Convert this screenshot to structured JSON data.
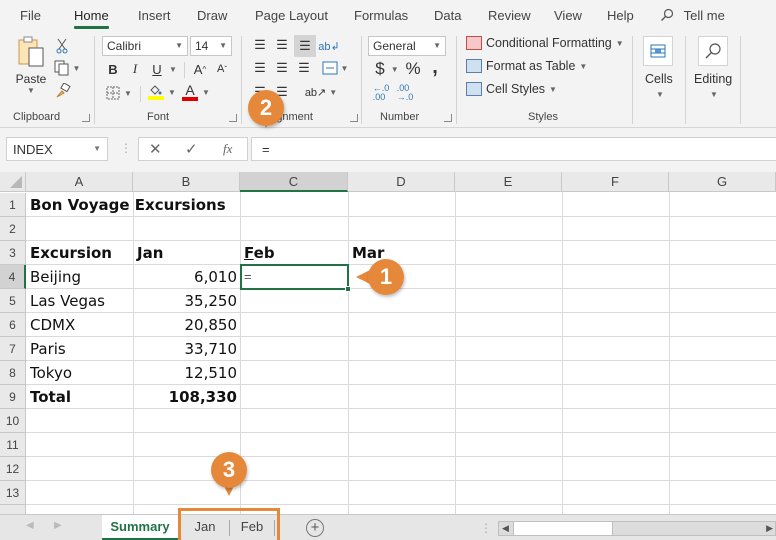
{
  "menu": {
    "tabs": [
      {
        "label": "File"
      },
      {
        "label": "Home",
        "active": true
      },
      {
        "label": "Insert"
      },
      {
        "label": "Draw"
      },
      {
        "label": "Page Layout"
      },
      {
        "label": "Formulas"
      },
      {
        "label": "Data"
      },
      {
        "label": "Review"
      },
      {
        "label": "View"
      },
      {
        "label": "Help"
      }
    ],
    "tell_me": "Tell me"
  },
  "ribbon": {
    "clipboard": {
      "paste_label": "Paste",
      "group_label": "Clipboard"
    },
    "font": {
      "font_name": "Calibri",
      "font_size": "14",
      "bold": "B",
      "italic": "I",
      "underline": "U",
      "grow": "A",
      "shrink": "A",
      "font_color_letter": "A",
      "group_label": "Font",
      "fill_color": "#ffff00",
      "font_color": "#e00000"
    },
    "alignment": {
      "group_label": "Alignment"
    },
    "number": {
      "format": "General",
      "currency": "$",
      "percent": "%",
      "comma": ",",
      "group_label": "Number"
    },
    "styles": {
      "conditional_formatting": "Conditional Formatting",
      "format_as_table": "Format as Table",
      "cell_styles": "Cell Styles",
      "group_label": "Styles"
    },
    "cells": {
      "label": "Cells"
    },
    "editing": {
      "label": "Editing"
    }
  },
  "formula_bar": {
    "name_box": "INDEX",
    "cancel": "✕",
    "enter": "✓",
    "fx": "fx",
    "formula": "="
  },
  "grid": {
    "columns": [
      "A",
      "B",
      "C",
      "D",
      "E",
      "F",
      "G"
    ],
    "selected_column": "C",
    "rows": [
      "1",
      "2",
      "3",
      "4",
      "5",
      "6",
      "7",
      "8",
      "9",
      "10",
      "11",
      "12",
      "13"
    ],
    "selected_row": "4",
    "active_cell": "C4",
    "active_cell_value": "=",
    "title": "Bon Voyage Excursions",
    "headers": [
      "Excursion",
      "Jan",
      "Feb",
      "Mar"
    ],
    "data": [
      {
        "excursion": "Beijing",
        "jan": "6,010"
      },
      {
        "excursion": "Las Vegas",
        "jan": "35,250"
      },
      {
        "excursion": "CDMX",
        "jan": "20,850"
      },
      {
        "excursion": "Paris",
        "jan": "33,710"
      },
      {
        "excursion": "Tokyo",
        "jan": "12,510"
      }
    ],
    "total": {
      "label": "Total",
      "jan": "108,330"
    }
  },
  "sheets": {
    "tabs": [
      {
        "label": "Summary",
        "active": true
      },
      {
        "label": "Jan"
      },
      {
        "label": "Feb"
      }
    ],
    "add_sheet": "+"
  },
  "callouts": [
    "1",
    "2",
    "3"
  ],
  "colors": {
    "accent": "#217346",
    "callout": "#e5883a"
  }
}
